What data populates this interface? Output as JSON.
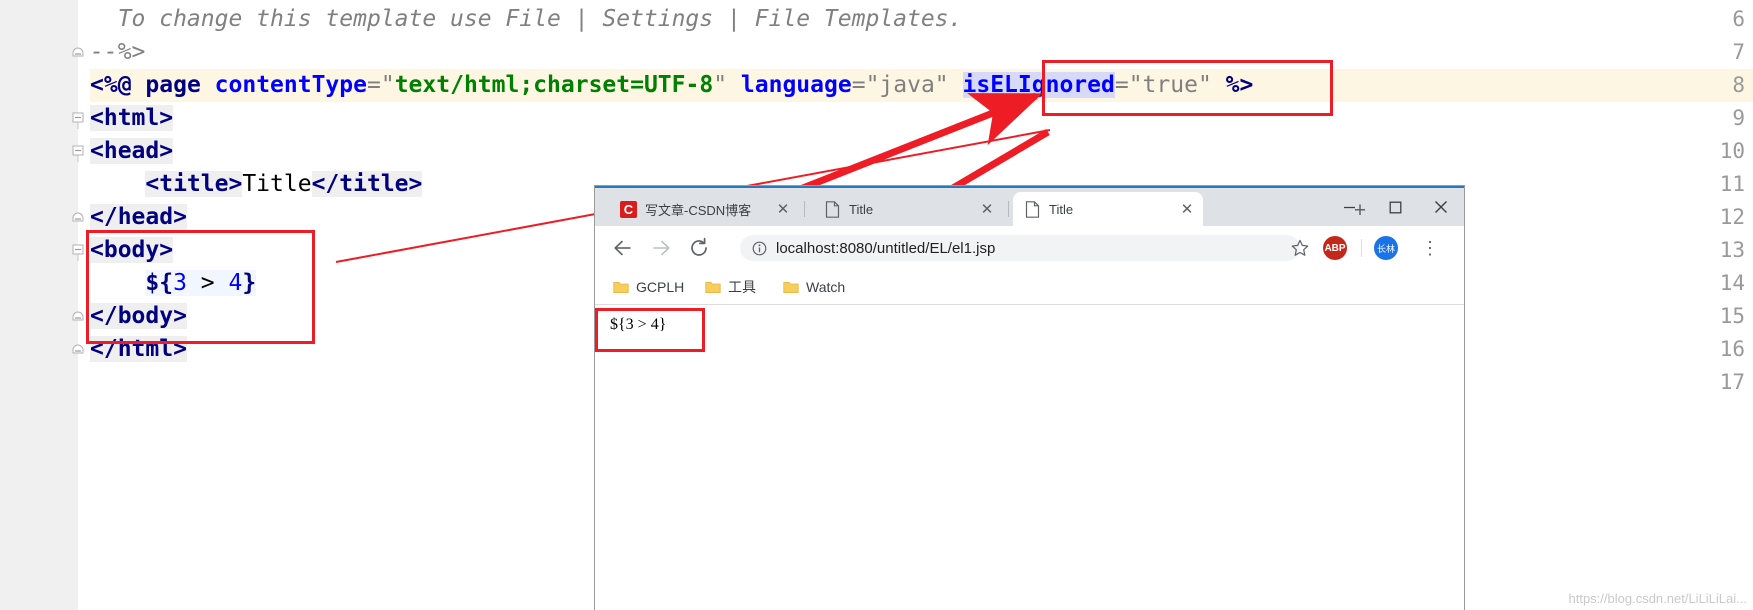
{
  "editor": {
    "lines": [
      {
        "num": "6",
        "fold": "none",
        "highlight": false
      },
      {
        "num": "7",
        "fold": "end",
        "highlight": false
      },
      {
        "num": "8",
        "fold": "none",
        "highlight": true
      },
      {
        "num": "9",
        "fold": "start",
        "highlight": false
      },
      {
        "num": "10",
        "fold": "start",
        "highlight": false
      },
      {
        "num": "11",
        "fold": "none",
        "highlight": false
      },
      {
        "num": "12",
        "fold": "end",
        "highlight": false
      },
      {
        "num": "13",
        "fold": "start",
        "highlight": false
      },
      {
        "num": "14",
        "fold": "none",
        "highlight": false
      },
      {
        "num": "15",
        "fold": "end",
        "highlight": false
      },
      {
        "num": "16",
        "fold": "end",
        "highlight": false
      },
      {
        "num": "17",
        "fold": "none",
        "highlight": false
      }
    ],
    "line_numbers": [
      "6",
      "7",
      "8",
      "9",
      "10",
      "11",
      "12",
      "13",
      "14",
      "15",
      "16",
      "17"
    ],
    "code": {
      "l6_comment": "  To change this template use File | Settings | File Templates.",
      "l7_close": "--%>",
      "l8_directive_open": "<%@",
      "l8_page": "page",
      "l8_attr1": "contentType",
      "l8_eq": "=",
      "l8_val1_quote_open": "\"",
      "l8_val1": "text/html;charset=UTF-8",
      "l8_val1_quote_close": "\"",
      "l8_attr2": "language",
      "l8_val2": "\"java\"",
      "l8_attr3": "isELIgnored",
      "l8_val3": "\"true\"",
      "l8_directive_close": "%>",
      "l9_html": "<html>",
      "l10_head": "<head>",
      "l11_title_open": "<title>",
      "l11_title_text": "Title",
      "l11_title_close": "</title>",
      "l12_head_close": "</head>",
      "l13_body": "<body>",
      "l14_el_dollar": "${",
      "l14_el_a": "3",
      "l14_el_op": " > ",
      "l14_el_b": "4",
      "l14_el_close": "}",
      "l15_body_close": "</body>",
      "l16_html_close": "</html>"
    }
  },
  "annotations": {
    "box_isel_label": "isELIgnored-attribute-highlight",
    "box_body_label": "jsp-body-el-expression-highlight",
    "box_output_label": "browser-rendered-output-highlight",
    "accent_color": "#ee1c25"
  },
  "browser": {
    "tabs": [
      {
        "title": "写文章-CSDN博客",
        "favicon": "csdn-logo-icon",
        "active": false,
        "closable": true
      },
      {
        "title": "Title",
        "favicon": "document-icon",
        "active": false,
        "closable": true
      },
      {
        "title": "Title",
        "favicon": "document-icon",
        "active": true,
        "closable": true
      }
    ],
    "new_tab_label": "+",
    "window_controls": {
      "minimize": "−",
      "maximize": "□",
      "close": "✕"
    },
    "toolbar": {
      "back": "back-arrow-icon",
      "forward": "forward-arrow-icon",
      "reload": "reload-icon",
      "url_prefix": "localhost:8080",
      "url_host": "localhost:",
      "url_port": "8080",
      "url_path": "/untitled/EL/el1.jsp",
      "url_full": "localhost:8080/untitled/EL/el1.jsp",
      "site_info": "info-circle-icon",
      "bookmark_star": "star-icon",
      "abp_label": "ABP",
      "avatar_label": "长林",
      "menu": "⋮"
    },
    "bookmarks": [
      {
        "label": "GCPLH",
        "icon": "folder-icon"
      },
      {
        "label": "工具",
        "icon": "folder-icon"
      },
      {
        "label": "Watch",
        "icon": "folder-icon"
      }
    ],
    "page": {
      "body_text": "${3 > 4}"
    }
  },
  "watermark": "https://blog.csdn.net/LiLiLiLai..."
}
